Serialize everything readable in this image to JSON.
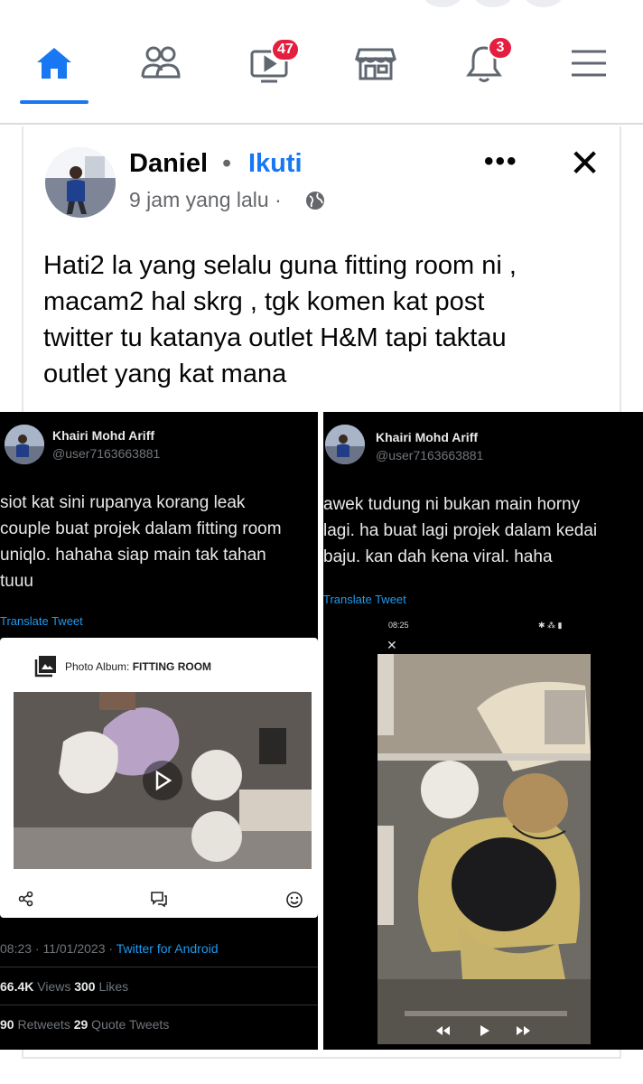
{
  "nav": {
    "items": [
      {
        "name": "home",
        "icon": "home-icon"
      },
      {
        "name": "friends",
        "icon": "friends-icon"
      },
      {
        "name": "watch",
        "icon": "video-icon",
        "badge": "47"
      },
      {
        "name": "marketplace",
        "icon": "store-icon"
      },
      {
        "name": "notifications",
        "icon": "bell-icon",
        "badge": "3"
      },
      {
        "name": "menu",
        "icon": "menu-icon"
      }
    ],
    "accent": "#1877f2",
    "badge_color": "#e41e3f"
  },
  "post": {
    "author": "Daniel",
    "separator": "•",
    "follow_label": "Ikuti",
    "timestamp": "9 jam yang lalu ·",
    "more_label": "•••",
    "close_label": "✕",
    "text_lines": [
      "Hati2 la yang selalu guna fitting room ni ,",
      "macam2 hal skrg , tgk komen kat post",
      "twitter tu katanya outlet H&M tapi taktau",
      "outlet yang kat mana"
    ]
  },
  "tweet_left": {
    "name": "Khairi Mohd Ariff",
    "handle": "@user7163663881",
    "body_lines": [
      "siot kat sini rupanya korang leak",
      "couple buat projek dalam fitting room",
      "uniqlo. hahaha siap main tak tahan",
      "tuuu"
    ],
    "translate": "Translate Tweet",
    "album_prefix": "Photo Album: ",
    "album_name": "FITTING ROOM",
    "timestamp": "08:23 · 11/01/2023 · ",
    "client": "Twitter for Android",
    "views_count": "66.4K",
    "views_label": " Views  ",
    "likes_count": "300",
    "likes_label": " Likes",
    "retweets_count": "90",
    "retweets_label": " Retweets  ",
    "quotes_count": "29",
    "quotes_label": " Quote Tweets"
  },
  "tweet_right": {
    "name": "Khairi Mohd Ariff",
    "handle": "@user7163663881",
    "body_lines": [
      "awek tudung ni bukan main horny",
      "lagi. ha buat lagi projek dalam kedai",
      "baju. kan dah kena viral. haha"
    ],
    "translate": "Translate Tweet",
    "phone_time": "08:25",
    "phone_status": "✱ ⁂ ▮",
    "viewer_close": "✕"
  }
}
